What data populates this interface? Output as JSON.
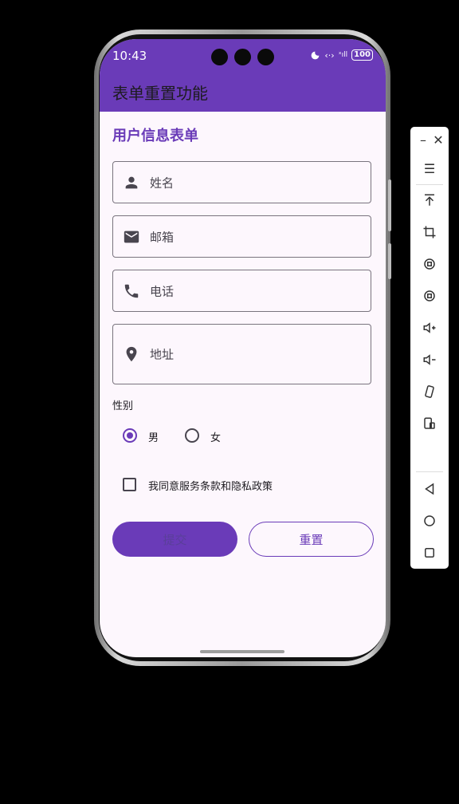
{
  "status_bar": {
    "time": "10:43",
    "battery": "100",
    "network": "‹·›",
    "signal": "ˣıll"
  },
  "app_bar": {
    "title": "表单重置功能"
  },
  "form": {
    "title": "用户信息表单",
    "fields": [
      {
        "name": "name",
        "placeholder": "姓名",
        "icon": "person-icon"
      },
      {
        "name": "email",
        "placeholder": "邮箱",
        "icon": "mail-icon"
      },
      {
        "name": "phone",
        "placeholder": "电话",
        "icon": "phone-icon"
      },
      {
        "name": "address",
        "placeholder": "地址",
        "icon": "location-icon"
      }
    ],
    "gender_label": "性别",
    "gender_options": [
      {
        "label": "男",
        "selected": true
      },
      {
        "label": "女",
        "selected": false
      }
    ],
    "agree_label": "我同意服务条款和隐私政策",
    "agree_checked": false,
    "submit_label": "提交",
    "reset_label": "重置"
  },
  "colors": {
    "primary": "#6a3bb8",
    "background": "#fdf7fd"
  }
}
